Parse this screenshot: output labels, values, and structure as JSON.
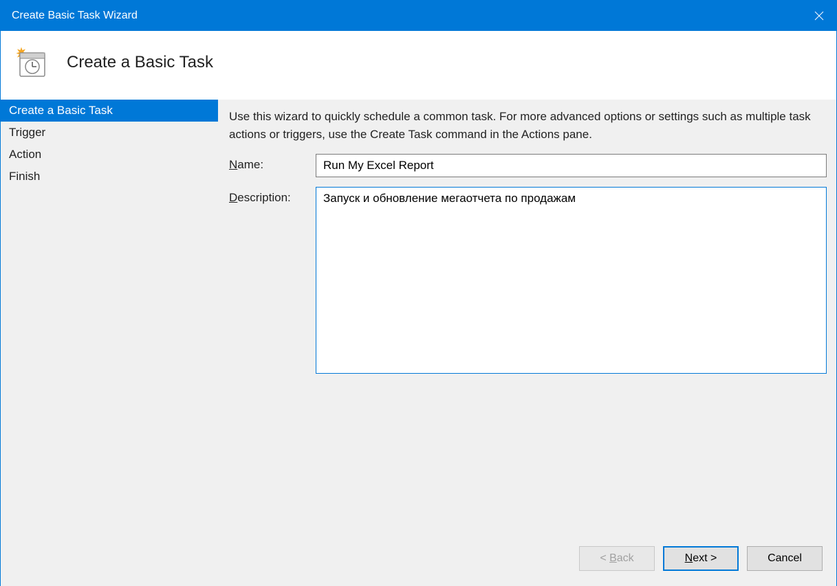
{
  "titlebar": {
    "title": "Create Basic Task Wizard"
  },
  "header": {
    "title": "Create a Basic Task"
  },
  "sidebar": {
    "items": [
      {
        "label": "Create a Basic Task",
        "active": true
      },
      {
        "label": "Trigger",
        "active": false
      },
      {
        "label": "Action",
        "active": false
      },
      {
        "label": "Finish",
        "active": false
      }
    ]
  },
  "main": {
    "instructions": "Use this wizard to quickly schedule a common task.  For more advanced options or settings such as multiple task actions or triggers, use the Create Task command in the Actions pane.",
    "name_label_pre": "N",
    "name_label_post": "ame:",
    "name_value": "Run My Excel Report",
    "desc_label_pre": "D",
    "desc_label_post": "escription:",
    "desc_value": "Запуск и обновление мегаотчета по продажам"
  },
  "footer": {
    "back_pre": "< ",
    "back_u": "B",
    "back_post": "ack",
    "next_u": "N",
    "next_post": "ext >",
    "cancel": "Cancel"
  }
}
